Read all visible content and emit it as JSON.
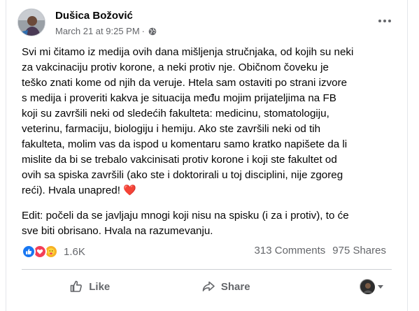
{
  "post": {
    "author": "Dušica Božović",
    "timestamp": "March 21 at 9:25 PM",
    "separator": "·",
    "privacy_icon": "globe-icon",
    "body": "Svi mi čitamo iz medija ovih dana mišljenja stručnjaka, od kojih su neki\nza vakcinaciju protiv korone, a neki protiv nje. Običnom čoveku je\nteško znati kome od njih da veruje. Htela sam ostaviti po strani izvore\ns medija i proveriti kakva je situacija među mojim prijateljima na FB\nkoji su završili neki od sledećih fakulteta: medicinu, stomatologiju,\nveterinu, farmaciju, biologiju i hemiju. Ako ste završili neki od tih\nfakulteta, molim vas da ispod u komentaru samo kratko napišete da li\nmislite da bi se trebalo vakcinisati protiv korone i koji ste fakultet od\novih sa spiska završili (ako ste i doktorirali u toj disciplini, nije zgoreg\nreći). Hvala unapred! ",
    "heart_emoji": "❤️",
    "edit": "Edit: počeli da se javljaju mnogi koji nisu na spisku (i za i protiv), to će\nsve biti obrisano. Hvala na razumevanju."
  },
  "stats": {
    "reactions": [
      "like",
      "love",
      "care"
    ],
    "reaction_count": "1.6K",
    "comments": "313 Comments",
    "shares": "975 Shares"
  },
  "actions": {
    "like_label": "Like",
    "share_label": "Share"
  },
  "colors": {
    "like_blue": "#1877f2",
    "love_red": "#f33e58",
    "care_yellow": "#f7b125",
    "secondary_text": "#65676b"
  }
}
